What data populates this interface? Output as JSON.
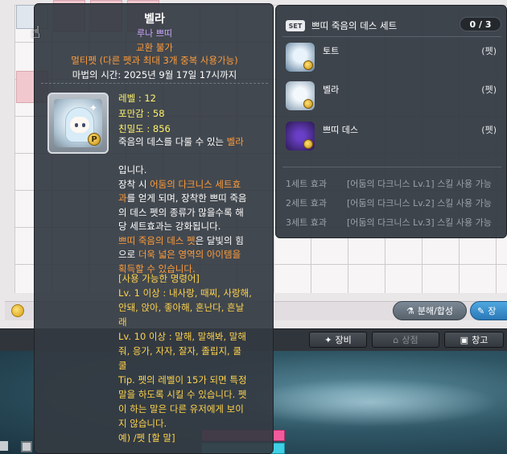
{
  "tooltip": {
    "name": "벨라",
    "subtitle": "루나 쁘띠",
    "no_trade": "교환 불가",
    "multi_pet": "멀티펫 (다른 펫과 최대 3개 중복 사용가능)",
    "magic_time": "마법의 시간: 2025년 9월 17일 17시까지",
    "stats": {
      "level": "레벨 : 12",
      "fullness": "포만감 : 58",
      "closeness": "친밀도 : 856"
    },
    "desc": {
      "l1a": "죽음의 데스를 다룰 수 있는 ",
      "l1b": "벨라",
      "l2": "입니다.",
      "l3a": "장착 시 ",
      "l3b": "어둠의 다크니스 세트효",
      "l4a": "과",
      "l4b": "를 얻게 되며, 장착한 쁘띠 죽음",
      "l5": "의 데스 펫의 종류가 많을수록 해",
      "l6": "당 세트효과는 강화됩니다.",
      "l7a": "쁘띠 죽음의 데스 펫",
      "l7b": "은 달빛의 힘",
      "l8a": "으로 ",
      "l8b": "더욱 넓은 영역의 아이템을",
      "l9": "획득할 수 있습니다."
    },
    "commands": {
      "header": "[사용 가능한 명령어]",
      "c1": "Lv. 1 이상 : 내사랑, 때찌, 사랑해,",
      "c2": "안돼, 앉아, 좋아해, 혼난다, 흔날",
      "c3": "래",
      "c4": "Lv. 10 이상 : 말해, 말해봐, 말해",
      "c5": "줘, 응가, 자자, 잘자, 졸립지, 쿨",
      "c6": "쿨",
      "c7": "Tip. 펫의 레벨이 15가 되면 특정",
      "c8": "말을 하도록 시킬 수 있습니다. 펫",
      "c9": "이 하는 말은 다른 유저에게 보이",
      "c10": "지 않습니다.",
      "c11": "예) /펫 [할 말]"
    }
  },
  "set_panel": {
    "badge": "SET",
    "title": "쁘띠 죽음의 데스 세트",
    "count": "0 / 3",
    "members": [
      {
        "name": "토트",
        "tag": "(펫)"
      },
      {
        "name": "벨라",
        "tag": "(펫)"
      },
      {
        "name": "쁘띠 데스",
        "tag": "(펫)"
      }
    ],
    "effects": [
      {
        "label": "1세트 효과",
        "value": "[어둠의 다크니스 Lv.1] 스킬 사용 가능"
      },
      {
        "label": "2세트 효과",
        "value": "[어둠의 다크니스 Lv.2] 스킬 사용 가능"
      },
      {
        "label": "3세트 효과",
        "value": "[어둠의 다크니스 Lv.3] 스킬 사용 가능"
      }
    ]
  },
  "buttons": {
    "decompose": "분해/합성",
    "equip_partial": "장",
    "equip": "장비",
    "shop": "상점",
    "storage": "창고"
  },
  "colors": {
    "tooltip_bg": "#343a42",
    "highlight_orange": "#ff9c3b",
    "stat_yellow": "#fff36b",
    "subtitle_purple": "#c9a5ff",
    "command_yellow": "#ffd34d"
  }
}
